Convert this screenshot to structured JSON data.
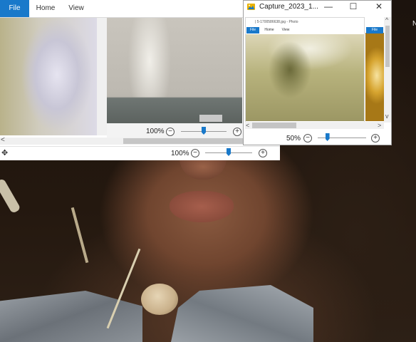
{
  "main_window": {
    "tabs": {
      "file": "File",
      "home": "Home",
      "view": "View"
    },
    "pane_zoom": "100%",
    "status_zoom": "100%",
    "zoom_out_symbol": "−",
    "zoom_in_symbol": "+",
    "move_symbol": "✥",
    "left_arrow": "<"
  },
  "capture_window": {
    "title": "Capture_2023_1...",
    "controls": {
      "minimize": "—",
      "maximize": "☐",
      "close": "✕"
    },
    "inner_path": "| 5-1700586638.jpg - Photo",
    "mini_tabs": {
      "file": "File",
      "home": "Home",
      "view": "View",
      "file2": "File"
    },
    "zoom": "50%",
    "zoom_out_symbol": "−",
    "zoom_in_symbol": "+",
    "scroll_up": "^",
    "scroll_down": "v",
    "scroll_left": "<",
    "scroll_right": ">"
  },
  "edge_text": "N",
  "levels": {
    "pane_zoom_slider_fraction": 0.5,
    "status_zoom_slider_fraction": 0.5,
    "capture_zoom_slider_fraction": 0.2
  },
  "colors": {
    "accent": "#1979ca"
  }
}
